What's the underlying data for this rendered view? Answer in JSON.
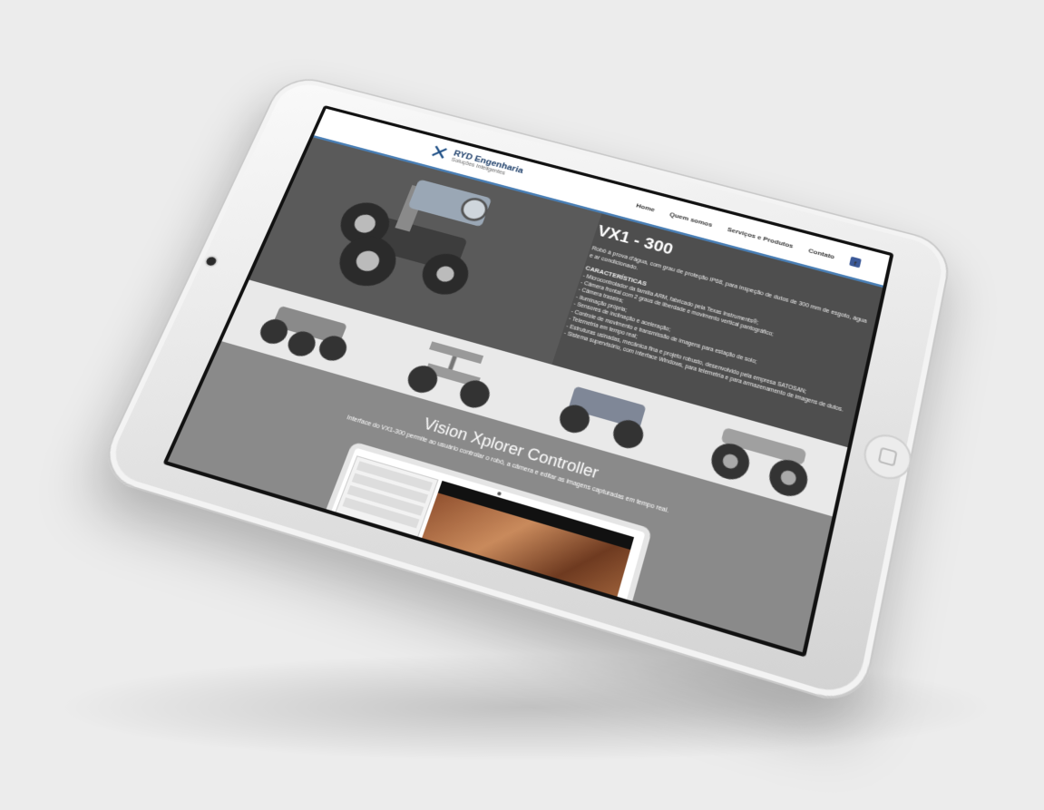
{
  "site": {
    "logo_name": "RYD Engenharia",
    "logo_tagline": "Soluções Inteligentes"
  },
  "nav": {
    "items": [
      "Home",
      "Quem somos",
      "Serviços e Produtos",
      "Contato"
    ],
    "facebook_icon": "facebook-icon"
  },
  "product": {
    "title": "VX1 - 300",
    "description": "Robô à prova d'água, com grau de proteção IP68, para inspeção de dutos de 300 mm de esgoto, água e ar condicionado.",
    "features_title": "CARACTERÍSTICAS",
    "features": [
      "- Microcontrolador da família ARM, fabricado pela Texas Instruments®;",
      "- Câmera frontal com 2 graus de liberdade e movimento vertical pantográfico;",
      "- Câmera traseira;",
      "- Iluminação própria;",
      "- Sensores de inclinação e aceleração;",
      "- Controle de movimento e transmissão de imagens para estação de solo;",
      "- Telemetria em tempo real;",
      "- Estruturas usinadas, mecânica fina e projeto robusto, desenvolvido pela empresa SATOSAN;",
      "- Sistema supervisório, com interface Windows, para telemetria e para armazenamento de imagens de dutos."
    ]
  },
  "controller": {
    "title": "Vision Xplorer Controller",
    "description": "Interface do VX1-300 permite ao usuário controlar o robô, a câmera e editar as imagens capturadas em tempo real."
  },
  "colors": {
    "accent": "#4a7fb5",
    "brand": "#1e3f6a",
    "facebook": "#3b5998"
  }
}
